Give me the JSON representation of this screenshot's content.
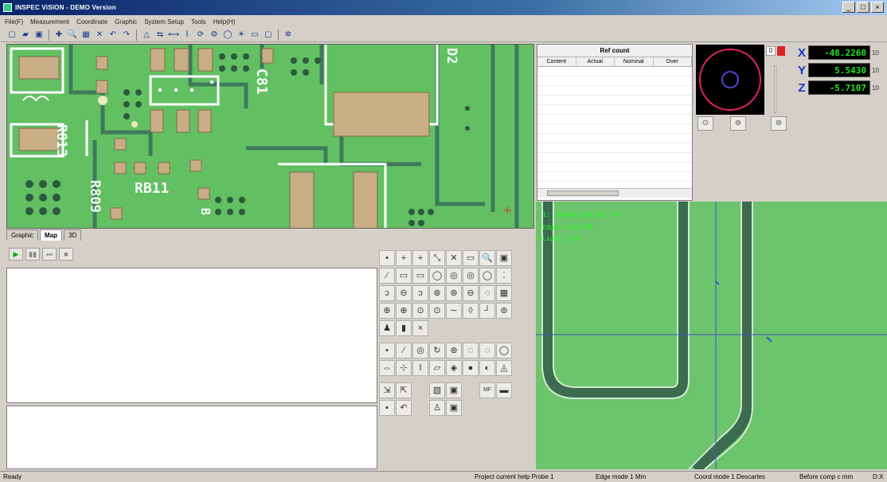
{
  "window": {
    "title": "INSPEC ViSION - DEMO Version",
    "controls": [
      "_",
      "□",
      "×"
    ]
  },
  "menu": [
    "File(F)",
    "Measurement",
    "Coordinate",
    "Graphic",
    "System Setup",
    "Tools",
    "Help(H)"
  ],
  "toolbar": {
    "icons": [
      "new-icon",
      "open-icon",
      "save-icon",
      "crosshair-icon",
      "zoom-icon",
      "grid-icon",
      "fit-icon",
      "undo-icon",
      "redo-icon",
      "align-icon",
      "axis-icon",
      "distance-icon",
      "height-icon",
      "rotate-icon",
      "settings-icon",
      "circle-icon",
      "light-icon",
      "frame-icon",
      "window-icon",
      "pin-icon"
    ],
    "glyphs": [
      "▢",
      "▰",
      "▣",
      "✚",
      "🔍",
      "▦",
      "✕",
      "↶",
      "↷",
      "△",
      "⇆",
      "⟷",
      "Ⅰ",
      "⟳",
      "⚙",
      "◯",
      "☀",
      "▭",
      "▢",
      "✲"
    ]
  },
  "camera_top": {
    "silk_labels": [
      "R813",
      "R809",
      "RB11",
      "C81",
      "D2",
      "B"
    ]
  },
  "view_tabs": [
    "Graphic",
    "Map",
    "3D"
  ],
  "program_controls": [
    "▶",
    "▮▮",
    "⏭",
    "■"
  ],
  "feature_buttons": [
    [
      "•",
      "+",
      "+",
      "⤡",
      "✕",
      "▭",
      "🔍",
      "▣"
    ],
    [
      "⁄",
      "▭",
      "▭",
      "◯",
      "◎",
      "◎",
      "◯",
      "⁚"
    ],
    [
      "ↄ",
      "⊖",
      "ↄ",
      "⊛",
      "⊛",
      "⊖",
      "◌",
      "▦"
    ],
    [
      "⊕",
      "⊕",
      "⊙",
      "⊙",
      "∼",
      "◊",
      "┘",
      "⊚"
    ],
    [
      "♟",
      "▮",
      "×"
    ],
    [
      "•",
      "⁄",
      "◎",
      "↻",
      "⊛",
      "◌",
      "◌",
      "◯"
    ],
    [
      "⇔",
      "⊹",
      "Ⅰ",
      "▱",
      "◈",
      "●",
      "◐",
      "◬"
    ],
    [
      "⇲",
      "⇱",
      "",
      "▧",
      "▣",
      "",
      "MF",
      "▬"
    ],
    [
      "▪",
      "↶",
      "",
      "♙",
      "▣"
    ]
  ],
  "result_table": {
    "title": "Ref count",
    "columns": [
      "Content",
      "Actual",
      "Nominal",
      "Over"
    ]
  },
  "probe": {
    "level": "0",
    "controls": [
      "⊙",
      "⊚",
      "⊚"
    ]
  },
  "dro": [
    {
      "axis": "X",
      "value": "-48.2260",
      "unit": "10"
    },
    {
      "axis": "Y",
      "value": "5.5430",
      "unit": "10"
    },
    {
      "axis": "Z",
      "value": "-5.7107",
      "unit": "10"
    }
  ],
  "camera_overlay": [
    "1: Zoom=0.500 Q5: 00",
    "Edge: 1.00 MM",
    "Light: 100"
  ],
  "status": {
    "ready": "Ready",
    "project": "Project current help Probe 1",
    "edge_mode": "Edge mode 1 Mm",
    "coord_mode": "Coord mode 1 Descartes",
    "comp": "Before comp c mm",
    "dx": "D:X"
  },
  "colors": {
    "pcb_green": "#5fbf5f",
    "pad_copper": "#c9ad84",
    "trace_dark": "#3e7a5a",
    "dro_text": "#1ee81e",
    "axis_label": "#1a35c8"
  }
}
